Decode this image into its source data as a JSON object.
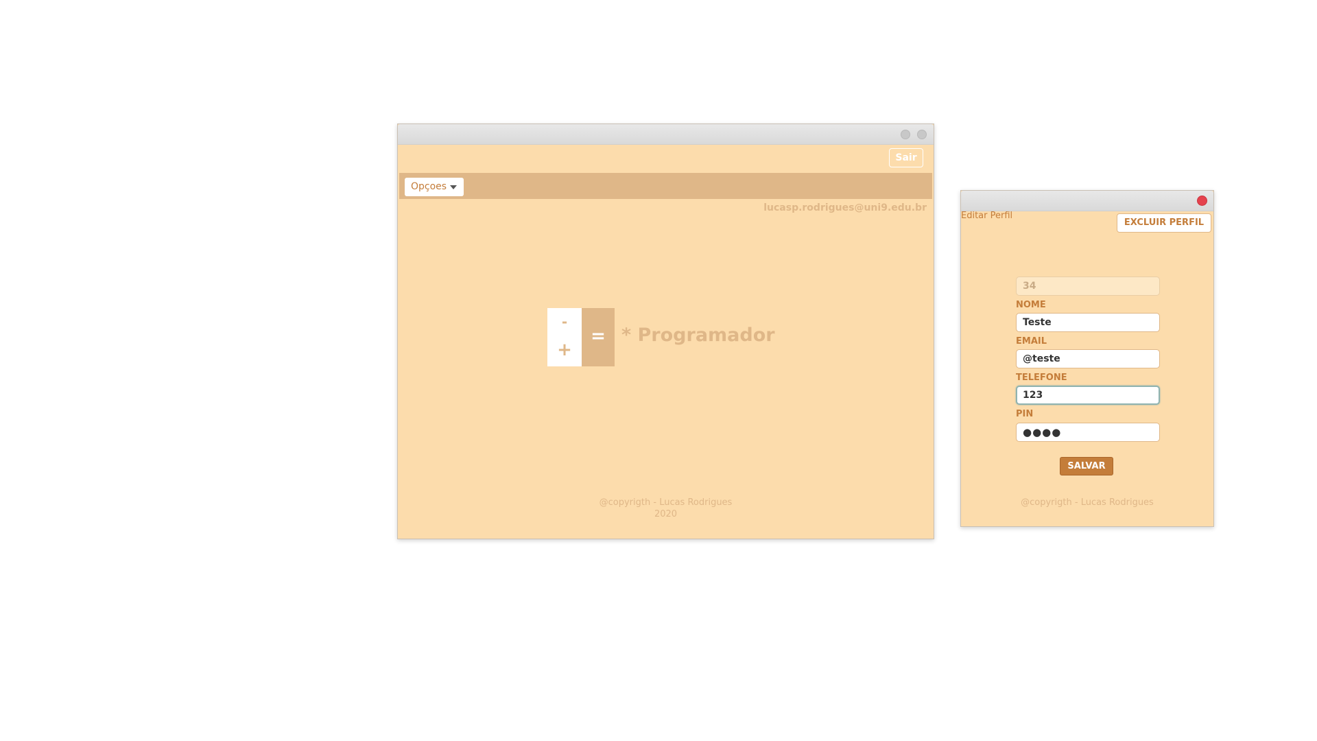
{
  "main_window": {
    "exit_label": "Sair",
    "menu_label": "Opçoes",
    "user_email": "lucasp.rodrigues@uni9.edu.br",
    "logo": {
      "minus": "-",
      "plus": "+",
      "equals": "=",
      "text": "* Programador"
    },
    "footer_line1": "@copyrigth - Lucas Rodrigues",
    "footer_line2": "2020"
  },
  "profile_window": {
    "title": "Editar Perfil",
    "delete_label": "EXCLUIR PERFIL",
    "id_value": "34",
    "fields": {
      "nome_label": "NOME",
      "nome_value": "Teste",
      "email_label": "EMAIL",
      "email_value": "@teste",
      "telefone_label": "TELEFONE",
      "telefone_value": "123",
      "pin_label": "PIN",
      "pin_value": "●●●●"
    },
    "save_label": "SALVAR",
    "footer": "@copyrigth - Lucas Rodrigues"
  },
  "colors": {
    "background": "#fcdcac",
    "accent": "#c47d3a",
    "muted": "#dfb788",
    "close": "#e5424d"
  }
}
